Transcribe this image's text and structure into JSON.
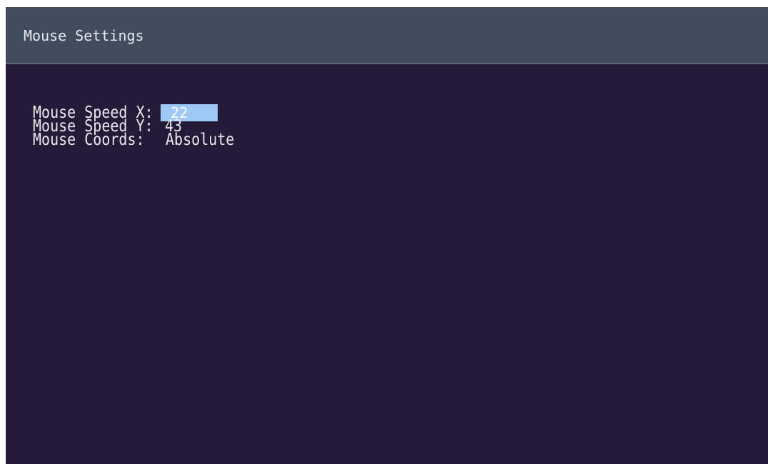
{
  "window": {
    "title": "Mouse Settings"
  },
  "settings": {
    "items": [
      {
        "label": "Mouse Speed X:",
        "value": "22",
        "selected": true
      },
      {
        "label": "Mouse Speed Y:",
        "value": "43",
        "selected": false
      },
      {
        "label": "Mouse Coords:",
        "value": "Absolute",
        "selected": false
      }
    ]
  },
  "colors": {
    "background": "#251a37",
    "title_bar": "#414d5d",
    "text": "#e9e9ef",
    "selection": "#9ec9f6"
  }
}
